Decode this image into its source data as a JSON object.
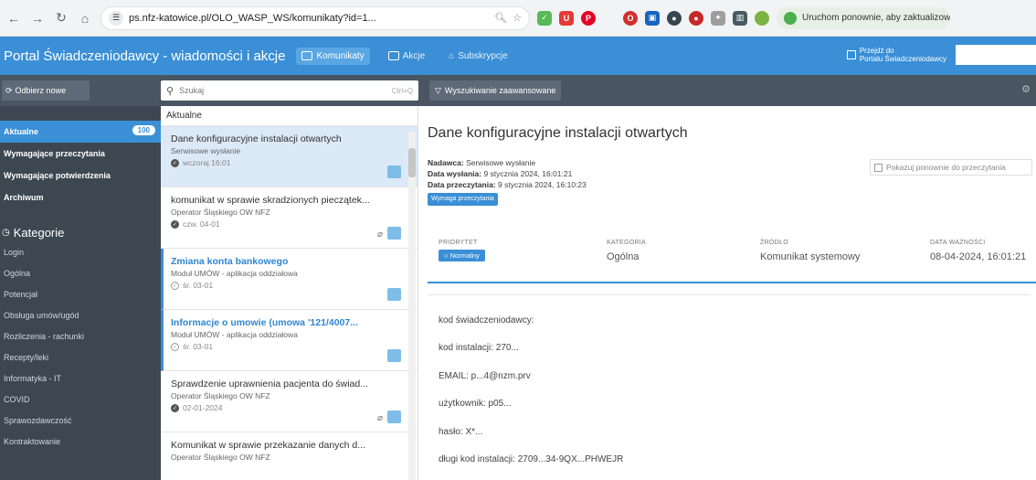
{
  "browser": {
    "url": "ps.nfz-katowice.pl/OLO_WASP_WS/komunikaty?id=1...",
    "relaunch_label": "Uruchom ponownie, aby zaktualizow"
  },
  "header": {
    "app_title": "Portal Świadczeniodawcy - wiadomości i akcje",
    "tabs": [
      {
        "label": "Komunikaty"
      },
      {
        "label": "Akcje"
      },
      {
        "label": "Subskrypcje"
      }
    ],
    "switch_line1": "Przejdź do",
    "switch_line2": "Portalu Świadczeniodawcy"
  },
  "toolbar": {
    "new_button": "Odbierz nowe",
    "search_placeholder": "Szukaj",
    "search_shortcut": "Ctrl+Q",
    "advanced_search": "Wyszukiwanie zaawansowane"
  },
  "sidebar": {
    "items": [
      {
        "label": "Aktualne",
        "count": "100"
      },
      {
        "label": "Wymagające przeczytania"
      },
      {
        "label": "Wymagające potwierdzenia"
      },
      {
        "label": "Archiwum"
      }
    ],
    "categories_title": "Kategorie",
    "categories": [
      "Login",
      "Ogólna",
      "Potencjał",
      "Obsługa umów/ugód",
      "Rozliczenia - rachunki",
      "Recepty/leki",
      "Informatyka - IT",
      "COVID",
      "Sprawozdawczość",
      "Kontraktowanie"
    ]
  },
  "list": {
    "header": "Aktualne",
    "messages": [
      {
        "title": "Dane konfiguracyjne instalacji otwartych",
        "sender": "Serwisowe wysłanie",
        "date": "wczoraj 16:01"
      },
      {
        "title": "komunikat w sprawie skradzionych pieczątek...",
        "sender": "Operator Śląskiego OW NFZ",
        "date": "czw. 04-01"
      },
      {
        "title": "Zmiana konta bankowego",
        "sender": "Moduł UMÓW - aplikacja oddziałowa",
        "date": "śr. 03-01"
      },
      {
        "title": "Informacje o umowie (umowa '121/4007...",
        "sender": "Moduł UMÓW - aplikacja oddziałowa",
        "date": "śr. 03-01"
      },
      {
        "title": "Sprawdzenie uprawnienia pacjenta do świad...",
        "sender": "Operator Śląskiego OW NFZ",
        "date": "02-01-2024"
      },
      {
        "title": "Komunikat w sprawie przekazanie danych d...",
        "sender": "Operator Śląskiego OW NFZ",
        "date": ""
      }
    ]
  },
  "detail": {
    "title": "Dane konfiguracyjne instalacji otwartych",
    "sender_label": "Nadawca:",
    "sender": "Serwisowe wysłanie",
    "sent_label": "Data wysłania:",
    "sent": "9 stycznia 2024, 16:01:21",
    "read_label": "Data przeczytania:",
    "read": "9 stycznia 2024, 16:10:23",
    "requires_read": "Wymaga przeczytania",
    "show_again": "Pokazuj ponownie do przeczytania",
    "props": {
      "priority_label": "PRIORYTET",
      "priority": "Normalny",
      "category_label": "KATEGORIA",
      "category": "Ogólna",
      "source_label": "ŹRÓDŁO",
      "source": "Komunikat systemowy",
      "validity_label": "DATA WAŻNOŚCI",
      "validity": "08-04-2024, 16:01:21"
    },
    "body_lines": [
      "kod świadczeniodawcy:",
      "kod instalacji: 270...",
      "EMAIL: p...4@nzm.prv",
      "użytkownik: p05...",
      "hasło: X*...",
      "długi kod instalacji: 2709...34-9QX...PHWEJR"
    ]
  }
}
